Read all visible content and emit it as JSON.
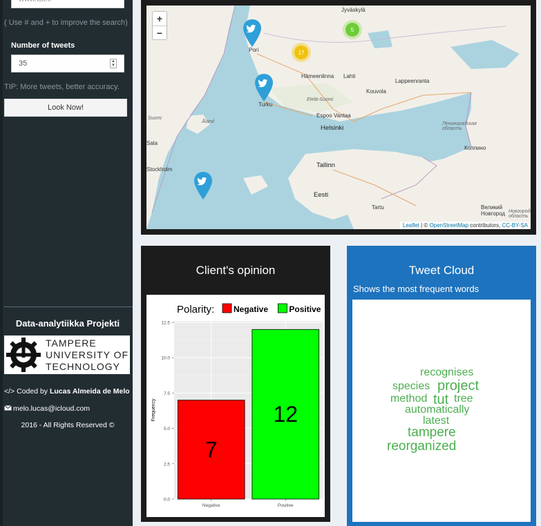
{
  "sidebar": {
    "search_value": "www.tut.fi",
    "search_hint": "( Use # and + to improve the search)",
    "tweets_label": "Number of tweets",
    "tweets_value": "35",
    "tip": "TIP: More tweets, better accuracy.",
    "button_label": "Look Now!",
    "project_title": "Data-analytiikka Projekti",
    "logo_lines": [
      "TAMPERE",
      "UNIVERSITY OF",
      "TECHNOLOGY"
    ],
    "coded_prefix": "</> Coded by ",
    "author": "Lucas Almeida de Melo",
    "email": "melo.lucas@icloud.com",
    "rights": "2016 - All Rights Reserved ©"
  },
  "map": {
    "zoom_in": "+",
    "zoom_out": "−",
    "attrib_leaflet": "Leaflet",
    "attrib_middle": " | © ",
    "attrib_osm": "OpenStreetMap",
    "attrib_contrib": " contributors, ",
    "attrib_license": "CC-BY-SA",
    "clusters": [
      "5",
      "17"
    ],
    "labels": {
      "jyvaskyla": "Jyväskylä",
      "pori": "Pori",
      "hameenlinna": "Hämeenlinna",
      "lahti": "Lahti",
      "lappeenranta": "Lappeenranta",
      "kouvola": "Kouvola",
      "turku": "Turku",
      "etela_suomi": "Etelä-Suomi",
      "espoo_vantaa": "Espoo Vantaa",
      "helsinki": "Helsinki",
      "aland": "Åland",
      "suomi": "Suomi",
      "tallinn": "Tallinn",
      "eesti": "Eesti",
      "tartu": "Tartu",
      "stockholm": "Stockholm",
      "sala": "Sala",
      "kolpino": "Колпино",
      "leningrad": "Ленинградская область",
      "velikiy": "Великий Новгород",
      "novgorod": "Новгородская область"
    }
  },
  "opinion": {
    "title": "Client's opinion"
  },
  "chart_data": {
    "type": "bar",
    "legend_title": "Polarity:",
    "legend_position": "top",
    "categories": [
      "Negative",
      "Positive"
    ],
    "values": [
      7,
      12
    ],
    "colors": [
      "#ff0000",
      "#00ff00"
    ],
    "ylabel": "Frequency",
    "ylim": [
      0,
      12.6
    ],
    "yticks": [
      "0.0",
      "2.5",
      "5.0",
      "7.5",
      "10.0",
      "12.5"
    ],
    "grid": true
  },
  "cloud": {
    "title": "Tweet Cloud",
    "subtitle": "Shows the most frequent words",
    "color": "#4caf50",
    "words": [
      "recognises",
      "species",
      "project",
      "method",
      "tut",
      "tree",
      "automatically",
      "latest",
      "tampere",
      "reorganized"
    ]
  }
}
